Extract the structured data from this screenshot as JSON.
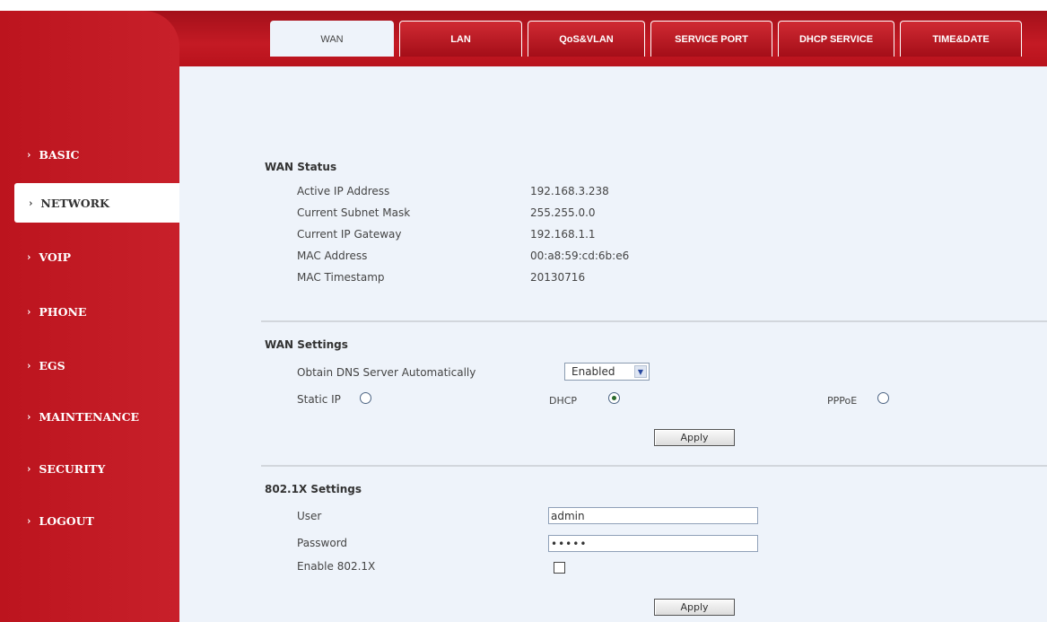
{
  "tabs": [
    {
      "label": "WAN",
      "active": true
    },
    {
      "label": "LAN",
      "active": false
    },
    {
      "label": "QoS&VLAN",
      "active": false
    },
    {
      "label": "SERVICE PORT",
      "active": false
    },
    {
      "label": "DHCP SERVICE",
      "active": false
    },
    {
      "label": "TIME&DATE",
      "active": false
    }
  ],
  "sidebar": {
    "chevron": "›",
    "items": [
      {
        "label": "BASIC",
        "active": false
      },
      {
        "label": "NETWORK",
        "active": true
      },
      {
        "label": "VOIP",
        "active": false
      },
      {
        "label": "PHONE",
        "active": false
      },
      {
        "label": "EGS",
        "active": false
      },
      {
        "label": "MAINTENANCE",
        "active": false
      },
      {
        "label": "SECURITY",
        "active": false
      },
      {
        "label": "LOGOUT",
        "active": false
      }
    ]
  },
  "wan_status": {
    "title": "WAN Status",
    "rows": [
      {
        "label": "Active IP Address",
        "value": "192.168.3.238"
      },
      {
        "label": "Current Subnet Mask",
        "value": "255.255.0.0"
      },
      {
        "label": "Current IP Gateway",
        "value": "192.168.1.1"
      },
      {
        "label": "MAC Address",
        "value": "00:a8:59:cd:6b:e6"
      },
      {
        "label": "MAC Timestamp",
        "value": "20130716"
      }
    ]
  },
  "wan_settings": {
    "title": "WAN Settings",
    "dns_label": "Obtain DNS Server Automatically",
    "dns_value": "Enabled",
    "dns_arrow": "▼",
    "static_ip_label": "Static IP",
    "dhcp_label": "DHCP",
    "pppoe_label": "PPPoE",
    "selected_mode": "DHCP",
    "apply_label": "Apply"
  },
  "dot1x": {
    "title": "802.1X Settings",
    "user_label": "User",
    "user_value": "admin",
    "password_label": "Password",
    "password_value": "•••••",
    "enable_label": "Enable 802.1X",
    "enable_checked": false,
    "apply_label": "Apply"
  },
  "colors": {
    "brand_red": "#c41a24",
    "panel_bg": "#eef3fa"
  }
}
